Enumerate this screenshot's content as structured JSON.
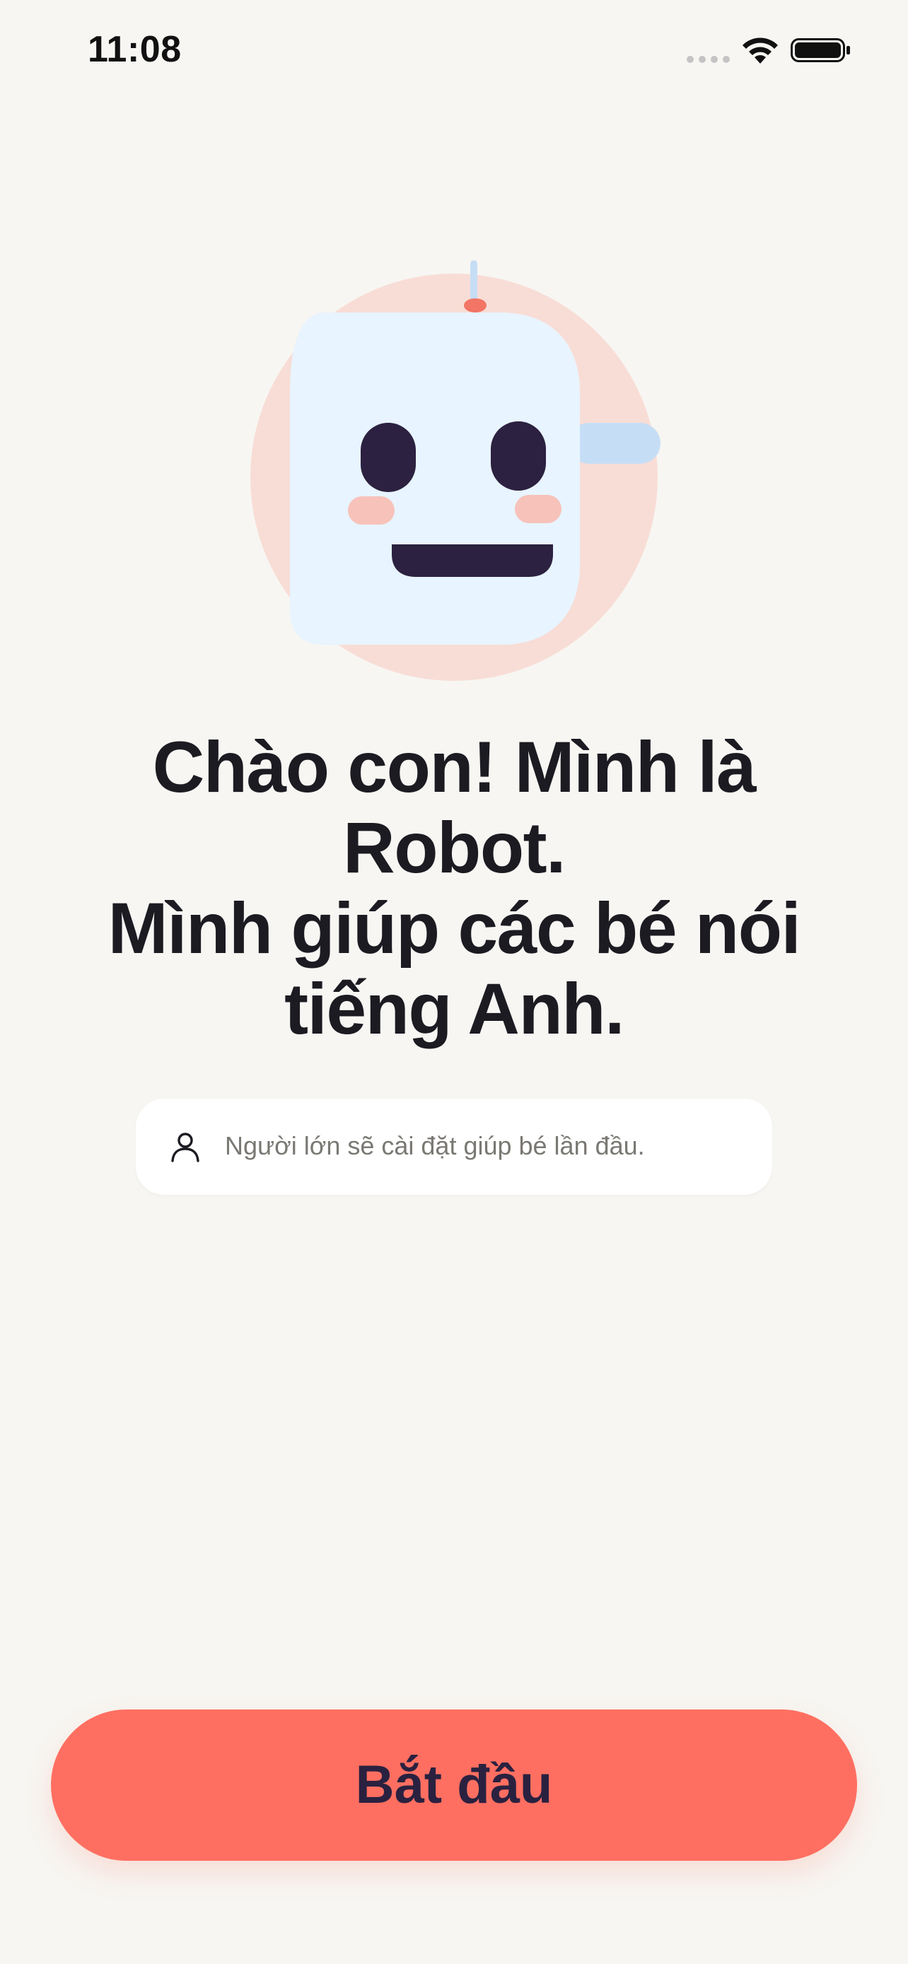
{
  "status_bar": {
    "time": "11:08"
  },
  "robot": {
    "icon": "robot-face-icon",
    "colors": {
      "halo": "#F8DDD6",
      "face": "#E8F4FF",
      "eyes": "#2C2140",
      "cheeks": "#F7C2BA",
      "antenna": "#C6DEF5",
      "antenna_tip": "#F27565",
      "ear": "#C6DEF5"
    }
  },
  "welcome": {
    "title_lines": [
      "Chào con! Mình là",
      "Robot.",
      "Mình giúp các bé nói",
      "tiếng Anh."
    ]
  },
  "parent_note": {
    "icon": "person-icon",
    "text": "Người lớn sẽ cài đặt giúp bé lần đầu."
  },
  "start_button": {
    "label": "Bắt đầu",
    "color": "#FF6F61"
  }
}
